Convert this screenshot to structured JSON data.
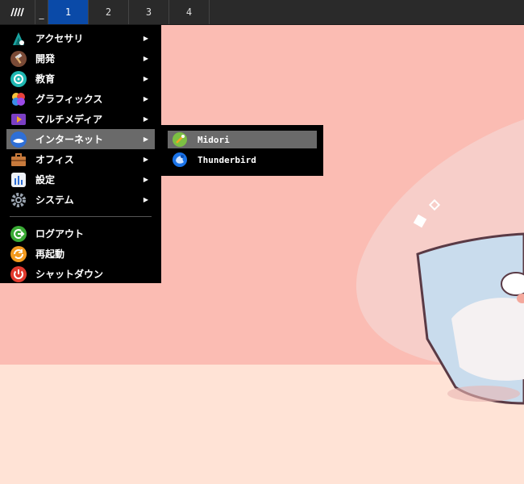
{
  "panel": {
    "menu_icon": "app-menu-icon",
    "separator_label": "_",
    "workspaces": [
      {
        "label": "1",
        "active": true
      },
      {
        "label": "2",
        "active": false
      },
      {
        "label": "3",
        "active": false
      },
      {
        "label": "4",
        "active": false
      }
    ],
    "active_color": "#0a4aa8"
  },
  "main_menu": {
    "items": [
      {
        "label": "アクセサリ",
        "icon": "accessories-icon",
        "has_submenu": true
      },
      {
        "label": "開発",
        "icon": "hammer-icon",
        "has_submenu": true
      },
      {
        "label": "教育",
        "icon": "education-icon",
        "has_submenu": true
      },
      {
        "label": "グラフィックス",
        "icon": "graphics-icon",
        "has_submenu": true
      },
      {
        "label": "マルチメディア",
        "icon": "multimedia-icon",
        "has_submenu": true
      },
      {
        "label": "インターネット",
        "icon": "internet-icon",
        "has_submenu": true,
        "highlighted": true
      },
      {
        "label": "オフィス",
        "icon": "briefcase-icon",
        "has_submenu": true
      },
      {
        "label": "設定",
        "icon": "settings-icon",
        "has_submenu": true
      },
      {
        "label": "システム",
        "icon": "gear-icon",
        "has_submenu": true
      }
    ],
    "session_items": [
      {
        "label": "ログアウト",
        "icon": "logout-icon"
      },
      {
        "label": "再起動",
        "icon": "restart-icon"
      },
      {
        "label": "シャットダウン",
        "icon": "power-icon"
      }
    ],
    "arrow_glyph": "▶"
  },
  "sub_menu": {
    "items": [
      {
        "label": "Midori",
        "icon": "midori-icon",
        "highlighted": true
      },
      {
        "label": "Thunderbird",
        "icon": "thunderbird-icon"
      }
    ]
  },
  "colors": {
    "wallpaper_pink": "#fbbcb3",
    "wallpaper_floor": "#ffe3d6",
    "highlight": "#6a6a6a"
  }
}
